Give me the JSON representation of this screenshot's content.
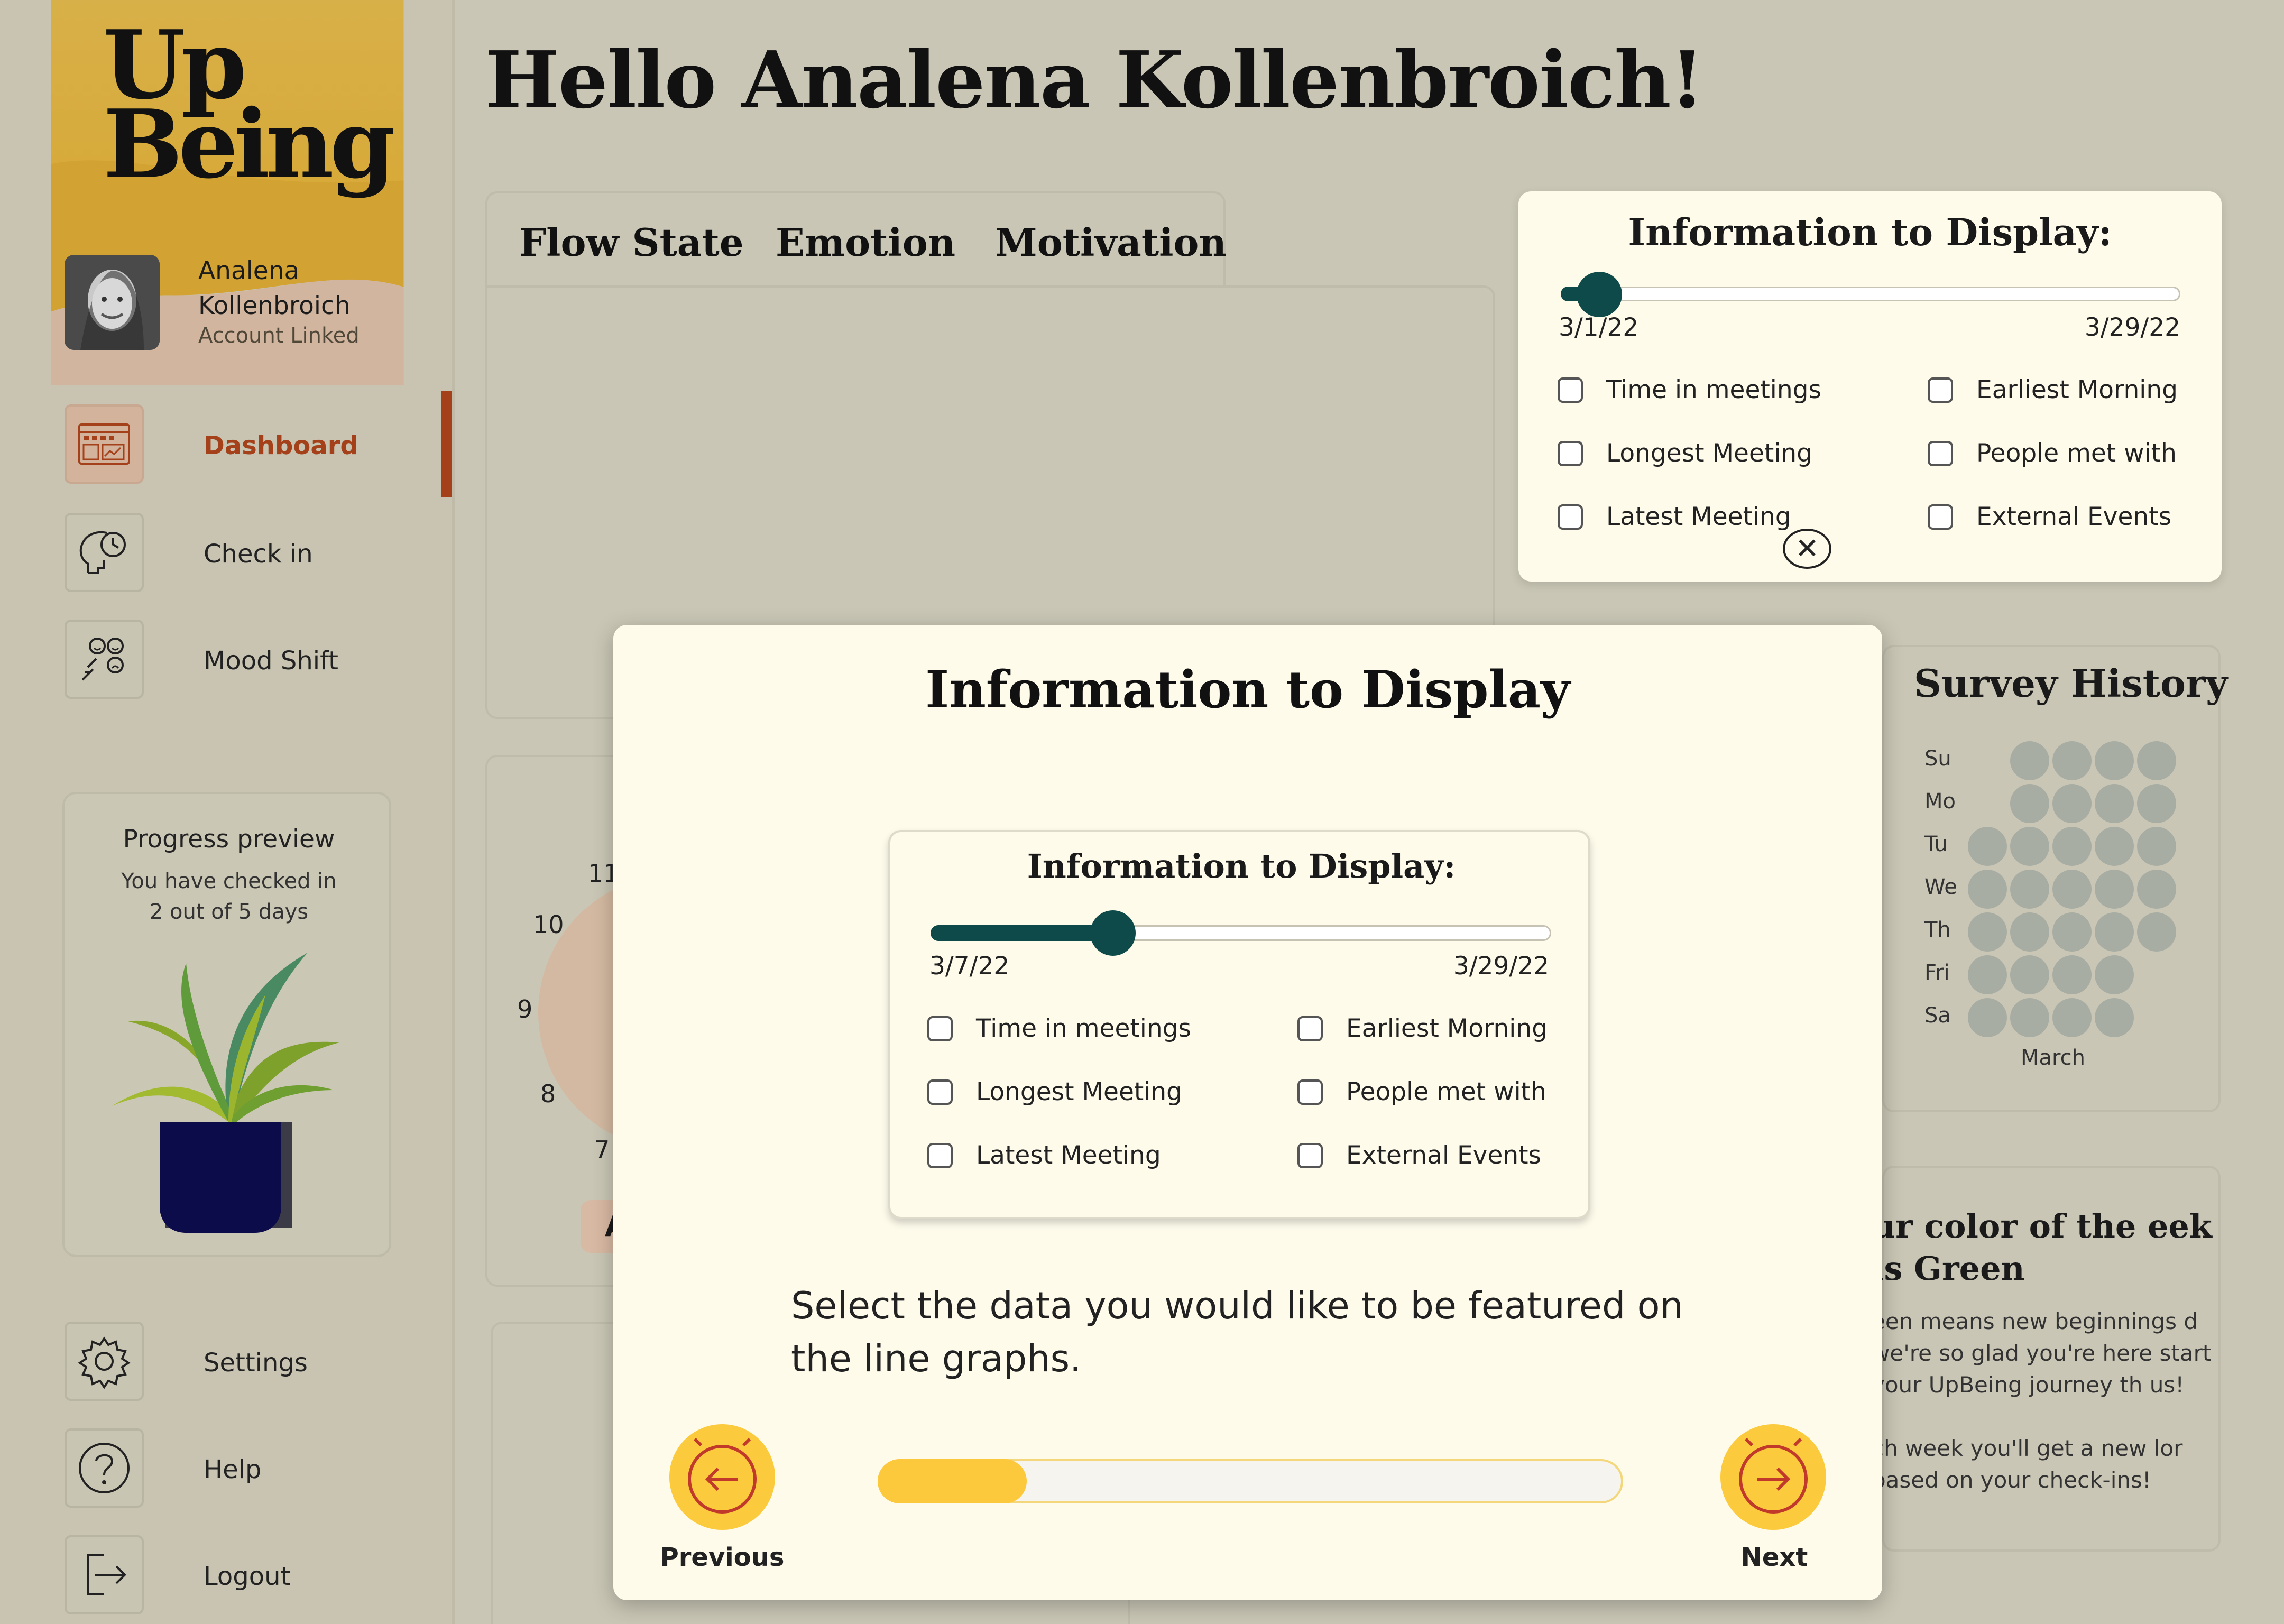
{
  "app": {
    "brand_line1": "Up",
    "brand_line2": "Being"
  },
  "user": {
    "name": "Analena Kollenbroich",
    "status": "Account Linked"
  },
  "sidebar": {
    "items": [
      {
        "label": "Dashboard",
        "icon": "dashboard-icon",
        "active": true
      },
      {
        "label": "Check in",
        "icon": "head-clock-icon"
      },
      {
        "label": "Mood Shift",
        "icon": "mood-shift-icon"
      },
      {
        "label": "Settings",
        "icon": "gear-icon"
      },
      {
        "label": "Help",
        "icon": "help-icon"
      },
      {
        "label": "Logout",
        "icon": "logout-icon"
      }
    ],
    "progress": {
      "title": "Progress preview",
      "text": "You have checked in 2 out of 5 days",
      "checked_in": 2,
      "total_days": 5
    }
  },
  "header": {
    "greeting": "Hello Analena Kollenbroich!"
  },
  "graph_tabs": [
    "Flow State",
    "Emotion",
    "Motivation"
  ],
  "clock": {
    "numbers": [
      "11",
      "10",
      "9",
      "8",
      "7"
    ],
    "button_label": "A"
  },
  "top_info": {
    "title": "Information to Display:",
    "start_date": "3/1/22",
    "end_date": "3/29/22",
    "slider_value": 0.04,
    "options": [
      "Time in meetings",
      "Earliest Morning",
      "Longest Meeting",
      "People met with",
      "Latest Meeting",
      "External Events"
    ]
  },
  "survey": {
    "title": "Survey History",
    "days": [
      "Su",
      "Mo",
      "Tu",
      "We",
      "Th",
      "Fri",
      "Sa"
    ],
    "month": "March"
  },
  "weekly_color": {
    "title": "ur color of the eek is Green",
    "text1": "een means new beginnings d we're so glad you're here start your UpBeing journey th us!",
    "text2": "ch week you'll get a new lor based on your check-ins!"
  },
  "modal": {
    "title": "Information to Display",
    "card": {
      "title": "Information to Display:",
      "start_date": "3/7/22",
      "end_date": "3/29/22",
      "slider_value": 0.25,
      "options": [
        "Time in meetings",
        "Earliest Morning",
        "Longest Meeting",
        "People met with",
        "Latest Meeting",
        "External Events"
      ]
    },
    "instructions": "Select the data you would like to be featured on the line graphs.",
    "progress": 0.2,
    "prev_label": "Previous",
    "next_label": "Next"
  },
  "colors": {
    "accent_dark": "#0e4a49",
    "accent_yellow": "#fcca3d",
    "active_nav": "#a4401a",
    "sidebar_yellow": "#dcae3a"
  }
}
